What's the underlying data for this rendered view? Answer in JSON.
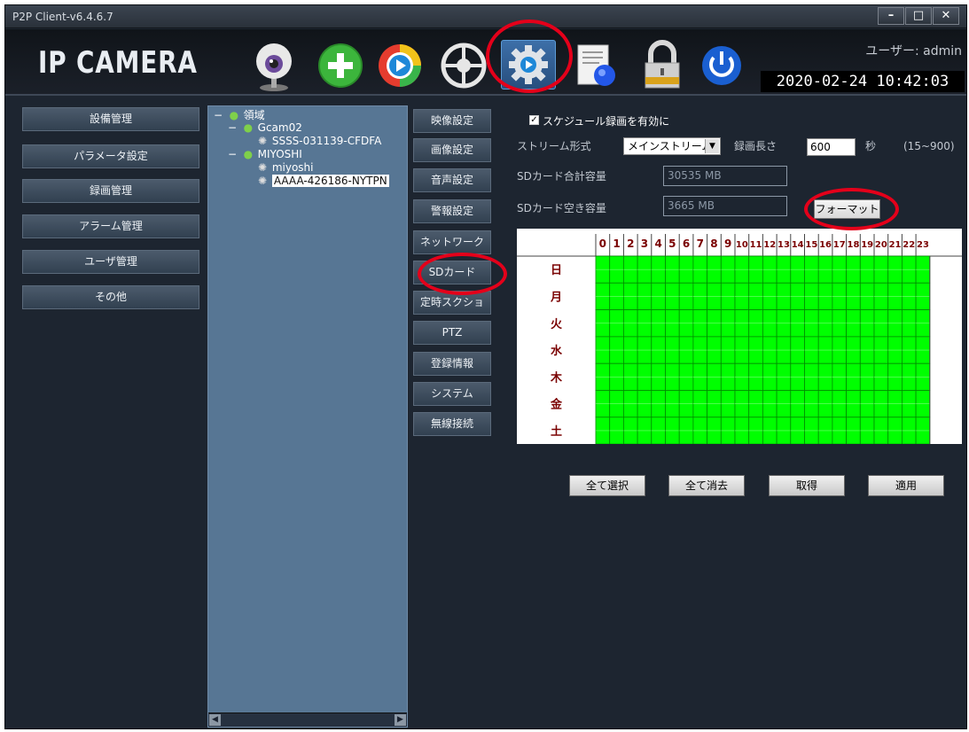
{
  "window": {
    "title": "P2P Client-v6.4.6.7"
  },
  "header": {
    "logo": "IP CAMERA",
    "user": "ユーザー: admin",
    "datetime": "2020-02-24 10:42:03"
  },
  "toolbar": [
    {
      "icon": "webcam-icon"
    },
    {
      "icon": "add-icon"
    },
    {
      "icon": "playback-icon"
    },
    {
      "icon": "ptz-wheel-icon"
    },
    {
      "icon": "settings-gear-icon",
      "active": true
    },
    {
      "icon": "log-document-icon"
    },
    {
      "icon": "lock-icon"
    },
    {
      "icon": "power-icon"
    }
  ],
  "left_nav": [
    "設備管理",
    "パラメータ設定",
    "録画管理",
    "アラーム管理",
    "ユーザ管理",
    "その他"
  ],
  "tree": {
    "root": "領域",
    "groups": [
      {
        "name": "Gcam02",
        "devices": [
          "SSSS-031139-CFDFA"
        ]
      },
      {
        "name": "MIYOSHI",
        "devices": [
          "miyoshi",
          "AAAA-426186-NYTPN"
        ]
      }
    ],
    "selected": "AAAA-426186-NYTPN"
  },
  "sub_nav": [
    "映像設定",
    "画像設定",
    "音声設定",
    "警報設定",
    "ネットワーク",
    "SDカード",
    "定時スクショ",
    "PTZ",
    "登録情報",
    "システム",
    "無線接続"
  ],
  "sd": {
    "enable_label": "スケジュール録画を有効に",
    "enabled": true,
    "stream_label": "ストリーム形式",
    "stream_value": "メインストリーム",
    "length_label": "録画長さ",
    "length_value": "600",
    "length_unit": "秒",
    "length_range": "(15~900)",
    "total_label": "SDカード合計容量",
    "total_value": "30535 MB",
    "free_label": "SDカード空き容量",
    "free_value": "3665 MB",
    "format_button": "フォーマット"
  },
  "schedule": {
    "hours": [
      "0",
      "1",
      "2",
      "3",
      "4",
      "5",
      "6",
      "7",
      "8",
      "9",
      "10",
      "11",
      "12",
      "13",
      "14",
      "15",
      "16",
      "17",
      "18",
      "19",
      "20",
      "21",
      "22",
      "23"
    ],
    "days": [
      "日",
      "月",
      "火",
      "水",
      "木",
      "金",
      "土"
    ],
    "all_selected": true,
    "fill_color": "#00ff00"
  },
  "actions": [
    "全て選択",
    "全て消去",
    "取得",
    "適用"
  ],
  "colors": {
    "accent_ring": "#e4001a",
    "window_bg": "#1d2530",
    "tree_bg": "#577694"
  }
}
